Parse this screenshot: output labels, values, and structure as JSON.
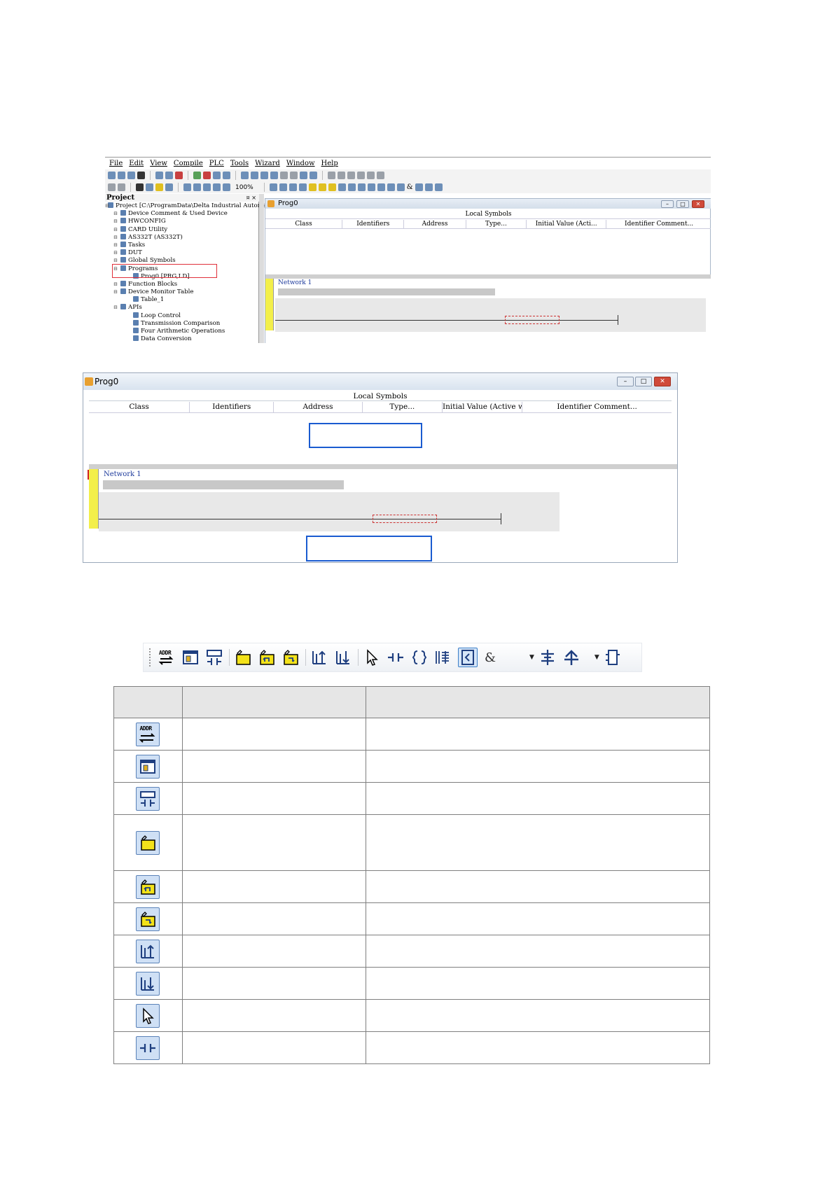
{
  "ide": {
    "menu": [
      "File",
      "Edit",
      "View",
      "Compile",
      "PLC",
      "Tools",
      "Wizard",
      "Window",
      "Help"
    ],
    "zoom": "100%",
    "project_panel": {
      "title": "Project",
      "pin": "¤ ×",
      "tree": [
        {
          "label": "Project [C:\\ProgramData\\Delta Industrial Automation",
          "level": 0
        },
        {
          "label": "Device Comment & Used Device",
          "level": 1
        },
        {
          "label": "HWCONFIG",
          "level": 1
        },
        {
          "label": "CARD Utility",
          "level": 1
        },
        {
          "label": "AS332T  (AS332T)",
          "level": 1
        },
        {
          "label": "Tasks",
          "level": 1
        },
        {
          "label": "DUT",
          "level": 1
        },
        {
          "label": "Global Symbols",
          "level": 1
        },
        {
          "label": "Programs",
          "level": 1
        },
        {
          "label": "Prog0 [PRG,LD]",
          "level": 2
        },
        {
          "label": "Function Blocks",
          "level": 1
        },
        {
          "label": "Device Monitor Table",
          "level": 1
        },
        {
          "label": "Table_1",
          "level": 2
        },
        {
          "label": "APIs",
          "level": 1
        },
        {
          "label": "Loop Control",
          "level": 2
        },
        {
          "label": "Transmission Comparison",
          "level": 2
        },
        {
          "label": "Four Arithmetic Operations",
          "level": 2
        },
        {
          "label": "Data Conversion",
          "level": 2
        }
      ]
    },
    "prog_window": {
      "title": "Prog0",
      "local_symbols": "Local Symbols",
      "columns": [
        "Class",
        "Identifiers",
        "Address",
        "Type...",
        "Initial Value (Acti...",
        "Identifier Comment..."
      ],
      "network": "Network 1"
    }
  },
  "prog_window2": {
    "title": "Prog0",
    "local_symbols": "Local Symbols",
    "columns": [
      "Class",
      "Identifiers",
      "Address",
      "Type...",
      "Initial Value (Active w...",
      "Identifier Comment..."
    ],
    "network": "Network 1"
  },
  "toolbar_strip": {
    "addr_label": "ADDR",
    "amp_label": "&",
    "icons": [
      "addr-toggle-icon",
      "symbol-table-icon",
      "contact-comment-icon",
      "edit-network-icon",
      "undo-network-icon",
      "redo-network-icon",
      "insert-row-up-icon",
      "insert-row-down-icon",
      "select-pointer-icon",
      "contact-icon",
      "coil-icon",
      "api-instruction-icon",
      "function-block-icon",
      "and-icon",
      "vertical-line-icon",
      "branch-up-icon",
      "box-icon"
    ]
  },
  "table": {
    "headers": [
      "",
      "",
      ""
    ],
    "rows": [
      {
        "icon": "addr-toggle-icon",
        "name": "",
        "desc": ""
      },
      {
        "icon": "symbol-table-icon",
        "name": "",
        "desc": ""
      },
      {
        "icon": "contact-comment-icon",
        "name": "",
        "desc": ""
      },
      {
        "icon": "edit-network-icon",
        "name": "",
        "desc": ""
      },
      {
        "icon": "undo-network-icon",
        "name": "",
        "desc": ""
      },
      {
        "icon": "redo-network-icon",
        "name": "",
        "desc": ""
      },
      {
        "icon": "insert-row-up-icon",
        "name": "",
        "desc": ""
      },
      {
        "icon": "insert-row-down-icon",
        "name": "",
        "desc": ""
      },
      {
        "icon": "select-pointer-icon",
        "name": "",
        "desc": ""
      },
      {
        "icon": "contact-icon",
        "name": "",
        "desc": ""
      }
    ]
  },
  "colors": {
    "highlight_red": "#e0303a",
    "callout_blue": "#1a5bd0",
    "network_yellow": "#f3ef4a",
    "icon_blue": "#1f4f9c"
  }
}
